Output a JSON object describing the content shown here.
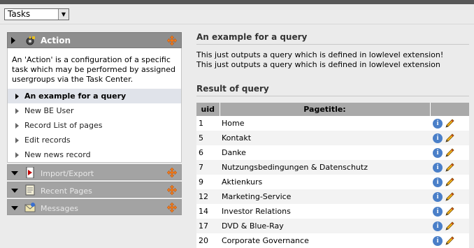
{
  "tasks_select": {
    "value": "Tasks"
  },
  "sidebar": {
    "action_panel": {
      "title": "Action",
      "description": "An 'Action' is a configuration of a specific task which may be performed by assigned usergroups via the Task Center.",
      "items": [
        {
          "label": "An example for a query",
          "active": true
        },
        {
          "label": "New BE User"
        },
        {
          "label": "Record List of pages"
        },
        {
          "label": "Edit records"
        },
        {
          "label": "New news record"
        }
      ]
    },
    "collapsed_panels": [
      {
        "title": "Import/Export",
        "icon": "import-export-icon"
      },
      {
        "title": "Recent Pages",
        "icon": "recent-pages-icon"
      },
      {
        "title": "Messages",
        "icon": "messages-icon"
      }
    ]
  },
  "main": {
    "heading": "An example for a query",
    "output_lines": [
      "This just outputs a query which is defined in lowlevel extension!",
      "This just outputs a query which is defined in lowlevel extension"
    ],
    "result_heading": "Result of query",
    "table": {
      "columns": [
        "uid",
        "Pagetitle:",
        ""
      ],
      "rows": [
        {
          "uid": "1",
          "title": "Home"
        },
        {
          "uid": "5",
          "title": "Kontakt"
        },
        {
          "uid": "6",
          "title": "Danke"
        },
        {
          "uid": "7",
          "title": "Nutzungsbedingungen & Datenschutz"
        },
        {
          "uid": "9",
          "title": "Aktienkurs"
        },
        {
          "uid": "12",
          "title": "Marketing-Service"
        },
        {
          "uid": "14",
          "title": "Investor Relations"
        },
        {
          "uid": "17",
          "title": "DVD & Blue-Ray"
        },
        {
          "uid": "20",
          "title": "Corporate Governance"
        }
      ],
      "row_actions": [
        "info-icon",
        "edit-pencil-icon"
      ]
    }
  },
  "colors": {
    "panel_header": "#8e8e8e",
    "table_header": "#a9a9a9",
    "active_item": "#e0e3ea"
  }
}
